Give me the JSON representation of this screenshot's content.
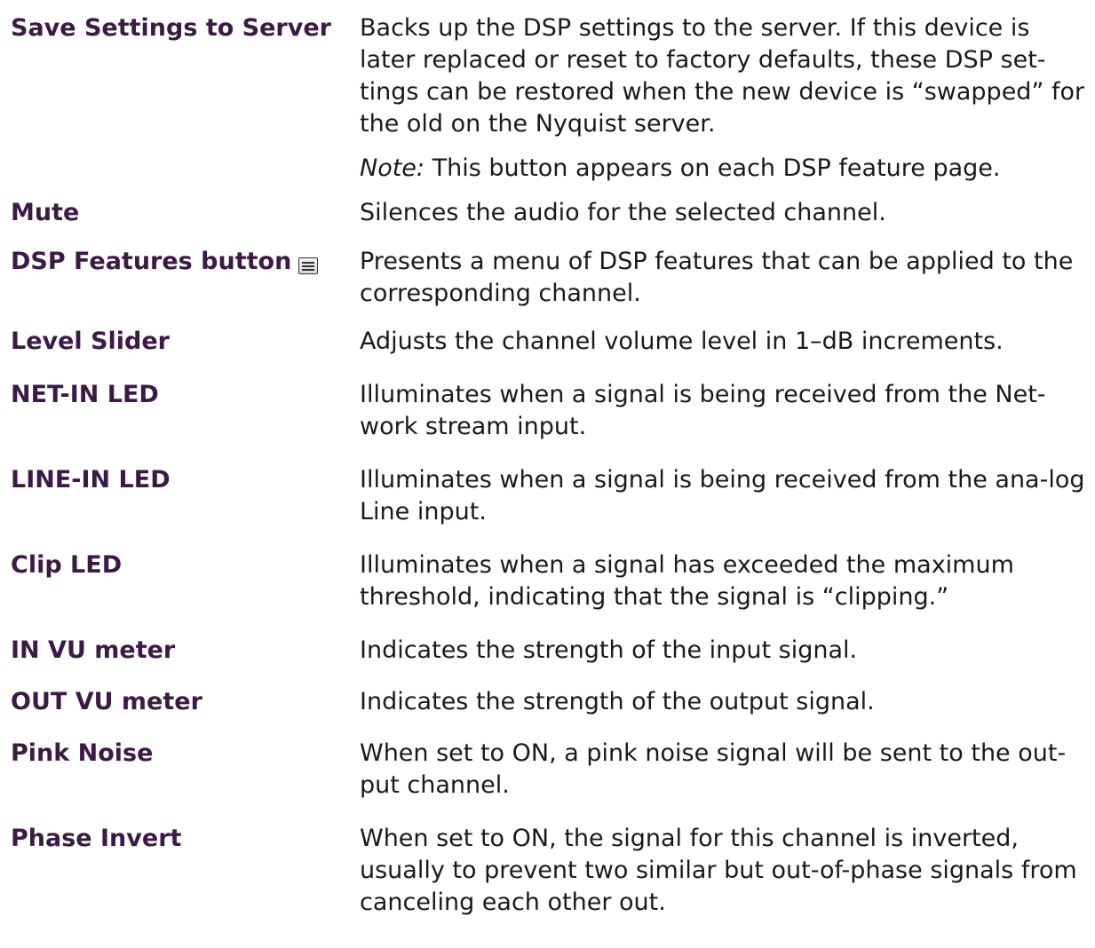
{
  "rows": [
    {
      "term": "Save Settings to Server",
      "desc": "Backs up the DSP settings to the server. If this device is later replaced or reset to factory defaults, these DSP set-tings can be restored when the new device is “swapped” for the old on the Nyquist server.",
      "note_label": "Note:",
      "note_text": " This button appears on each DSP feature page."
    },
    {
      "term": "Mute",
      "desc": "Silences the audio for the selected channel."
    },
    {
      "term": "DSP Features button",
      "desc": "Presents a menu of DSP features that can be applied to the corresponding channel."
    },
    {
      "term": "Level Slider",
      "desc": "Adjusts the channel volume level in 1–dB increments."
    },
    {
      "term": "NET-IN LED",
      "desc": "Illuminates when a signal is being received from the Net-work stream input."
    },
    {
      "term": "LINE-IN LED",
      "desc": "Illuminates when a signal is being received from the ana-log Line input."
    },
    {
      "term": "Clip LED",
      "desc": "Illuminates when a signal has exceeded the maximum threshold, indicating that the signal is “clipping.”"
    },
    {
      "term": "IN VU meter",
      "desc": "Indicates the strength of the input signal."
    },
    {
      "term": "OUT VU meter",
      "desc": "Indicates the strength of the output signal."
    },
    {
      "term": "Pink Noise",
      "desc": "When set to ON, a pink noise signal will be sent to the out-put channel."
    },
    {
      "term": "Phase Invert",
      "desc": "When set to ON, the signal for this channel is inverted, usually to prevent two similar but out-of-phase signals from canceling each other out."
    }
  ],
  "icons": {
    "dsp_features": "menu-icon"
  },
  "colors": {
    "term": "#3d1a45",
    "body": "#1a1a1a"
  }
}
